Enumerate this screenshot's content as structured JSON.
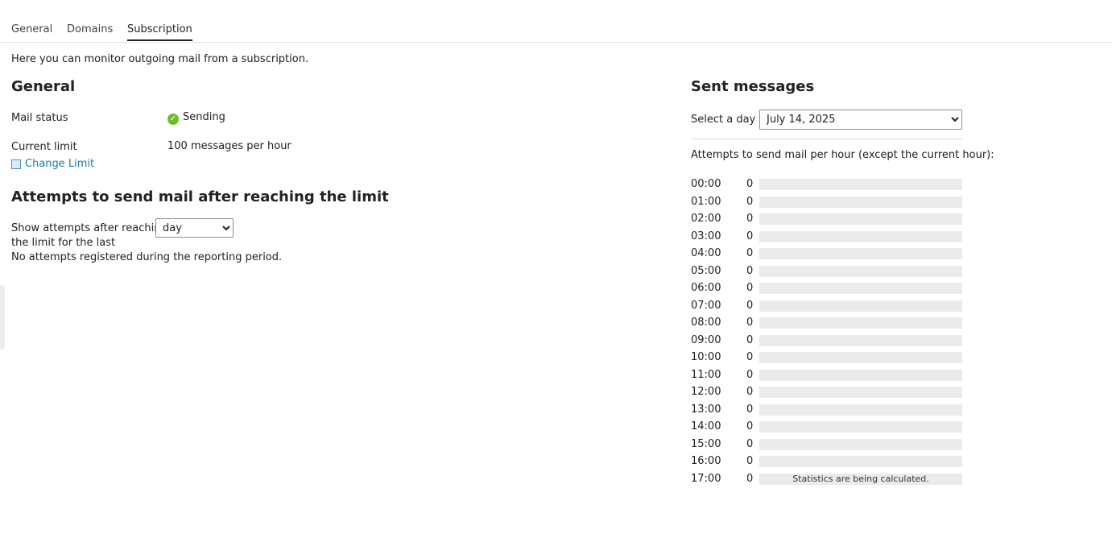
{
  "tabs": [
    {
      "label": "General"
    },
    {
      "label": "Domains"
    },
    {
      "label": "Subscription",
      "active": true
    }
  ],
  "intro_text": "Here you can monitor outgoing mail from a subscription.",
  "general": {
    "heading": "General",
    "mail_status_label": "Mail status",
    "mail_status_value": "Sending",
    "mail_status_icon": "check-circle-icon",
    "current_limit_label": "Current limit",
    "current_limit_value": "100 messages per hour",
    "change_limit_link": "Change Limit",
    "change_limit_icon": "edit-icon"
  },
  "attempts": {
    "heading": "Attempts to send mail after reaching the limit",
    "show_label_line1": "Show attempts after reaching",
    "show_label_line2": "the limit for the last",
    "period_select_value": "day",
    "empty_message": "No attempts registered during the reporting period."
  },
  "sent": {
    "heading": "Sent messages",
    "select_day_label": "Select a day :",
    "select_day_value": "July 14, 2025",
    "per_hour_caption": "Attempts to send mail per hour (except the current hour):",
    "rows": [
      {
        "hour": "00:00",
        "count": "0"
      },
      {
        "hour": "01:00",
        "count": "0"
      },
      {
        "hour": "02:00",
        "count": "0"
      },
      {
        "hour": "03:00",
        "count": "0"
      },
      {
        "hour": "04:00",
        "count": "0"
      },
      {
        "hour": "05:00",
        "count": "0"
      },
      {
        "hour": "06:00",
        "count": "0"
      },
      {
        "hour": "07:00",
        "count": "0"
      },
      {
        "hour": "08:00",
        "count": "0"
      },
      {
        "hour": "09:00",
        "count": "0"
      },
      {
        "hour": "10:00",
        "count": "0"
      },
      {
        "hour": "11:00",
        "count": "0"
      },
      {
        "hour": "12:00",
        "count": "0"
      },
      {
        "hour": "13:00",
        "count": "0"
      },
      {
        "hour": "14:00",
        "count": "0"
      },
      {
        "hour": "15:00",
        "count": "0"
      },
      {
        "hour": "16:00",
        "count": "0"
      },
      {
        "hour": "17:00",
        "count": "0",
        "note": "Statistics are being calculated."
      }
    ]
  }
}
